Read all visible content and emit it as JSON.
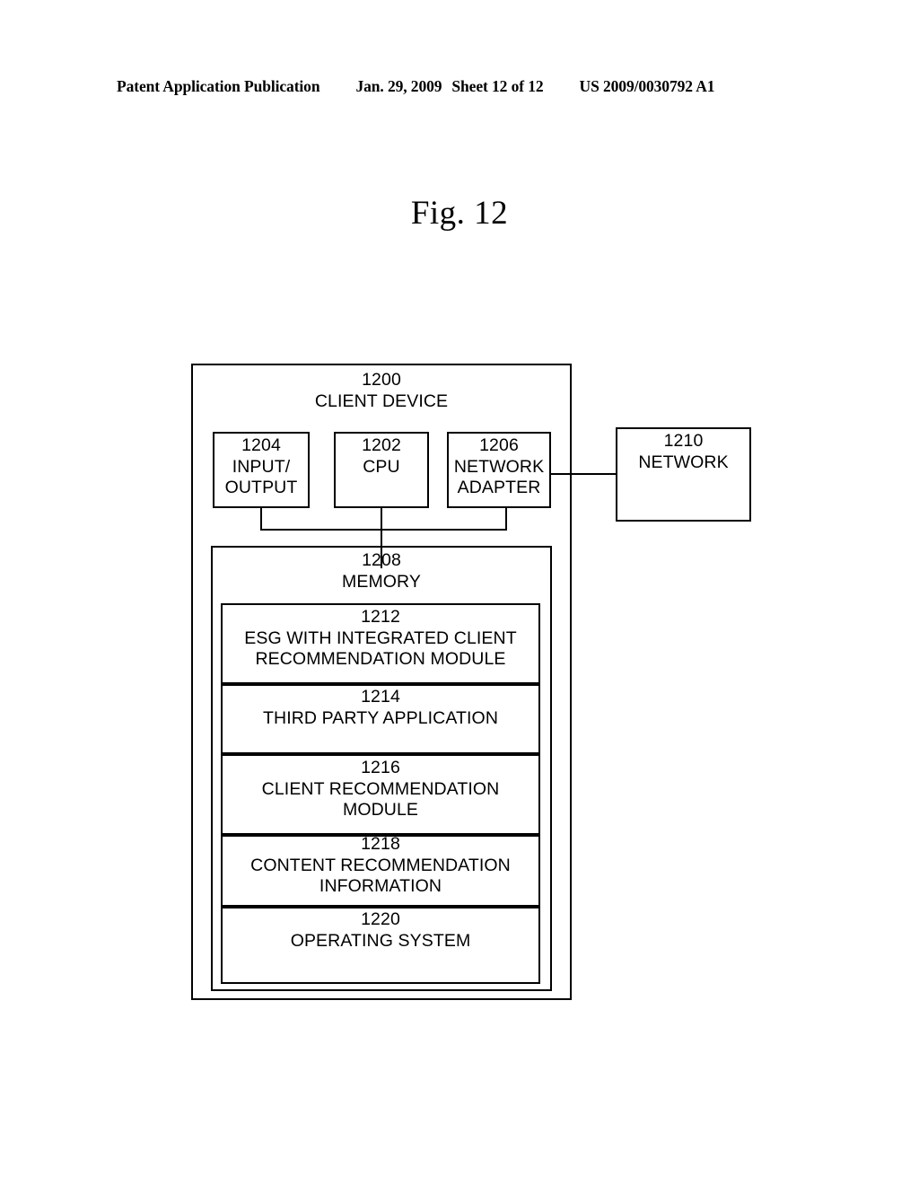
{
  "header": {
    "publication": "Patent Application Publication",
    "date": "Jan. 29, 2009",
    "sheet": "Sheet 12 of 12",
    "patent_number": "US 2009/0030792 A1"
  },
  "figure": {
    "title": "Fig. 12"
  },
  "diagram": {
    "client_device": {
      "ref": "1200",
      "name": "CLIENT DEVICE",
      "label": "1200\nCLIENT DEVICE"
    },
    "input_output": {
      "ref": "1204",
      "name": "INPUT/ OUTPUT",
      "label": "1204\nINPUT/\nOUTPUT"
    },
    "cpu": {
      "ref": "1202",
      "name": "CPU",
      "label": "1202\nCPU"
    },
    "network_adapter": {
      "ref": "1206",
      "name": "NETWORK ADAPTER",
      "label": "1206\nNETWORK\nADAPTER"
    },
    "network": {
      "ref": "1210",
      "name": "NETWORK",
      "label": "1210\nNETWORK"
    },
    "memory": {
      "ref": "1208",
      "name": "MEMORY",
      "label": "1208\nMEMORY"
    },
    "memory_modules": [
      {
        "ref": "1212",
        "name": "ESG WITH INTEGRATED CLIENT RECOMMENDATION MODULE",
        "label": "1212\nESG WITH INTEGRATED CLIENT\nRECOMMENDATION MODULE"
      },
      {
        "ref": "1214",
        "name": "THIRD PARTY APPLICATION",
        "label": "1214\nTHIRD PARTY APPLICATION"
      },
      {
        "ref": "1216",
        "name": "CLIENT RECOMMENDATION MODULE",
        "label": "1216\nCLIENT RECOMMENDATION\nMODULE"
      },
      {
        "ref": "1218",
        "name": "CONTENT RECOMMENDATION INFORMATION",
        "label": "1218\nCONTENT RECOMMENDATION\nINFORMATION"
      },
      {
        "ref": "1220",
        "name": "OPERATING SYSTEM",
        "label": "1220\nOPERATING SYSTEM"
      }
    ]
  }
}
